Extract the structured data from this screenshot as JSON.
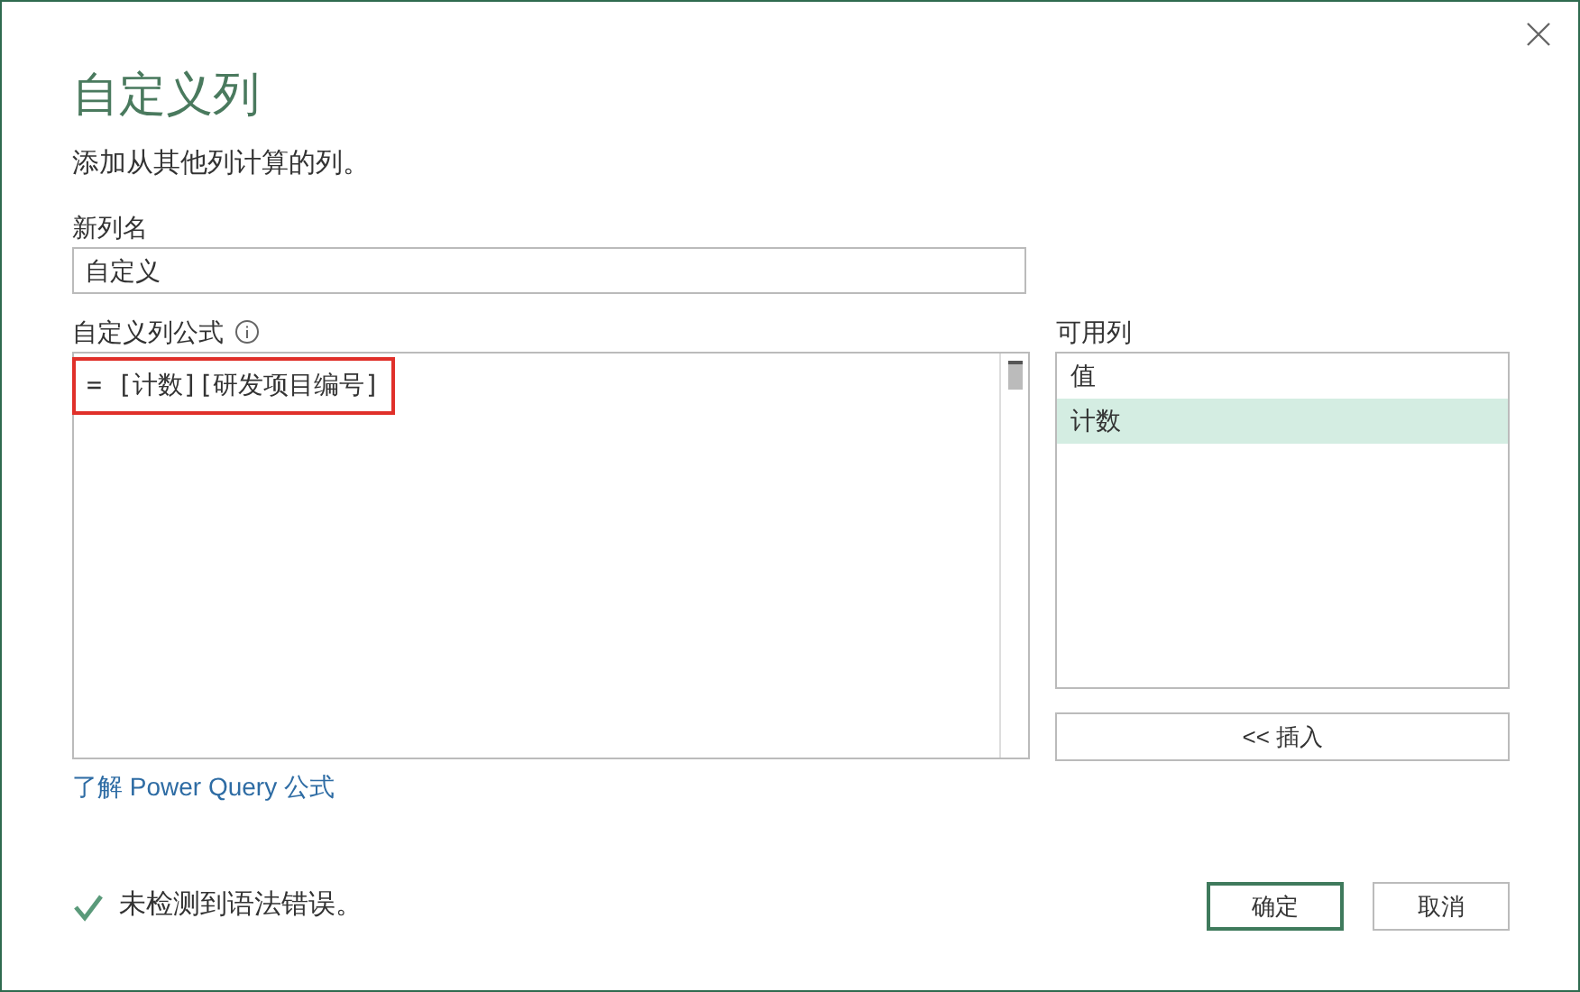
{
  "dialog": {
    "title": "自定义列",
    "description": "添加从其他列计算的列。"
  },
  "new_column_name": {
    "label": "新列名",
    "value": "自定义"
  },
  "formula": {
    "label": "自定义列公式",
    "value": "= [计数][研发项目编号]",
    "highlighted": true
  },
  "available_columns": {
    "label": "可用列",
    "items": [
      {
        "label": "值",
        "selected": false
      },
      {
        "label": "计数",
        "selected": true
      }
    ],
    "insert_button": "<< 插入"
  },
  "help_link": "了解 Power Query 公式",
  "status": {
    "ok": true,
    "text": "未检测到语法错误。"
  },
  "buttons": [
    {
      "label": "确定",
      "primary": true
    },
    {
      "label": "取消",
      "primary": false
    }
  ]
}
